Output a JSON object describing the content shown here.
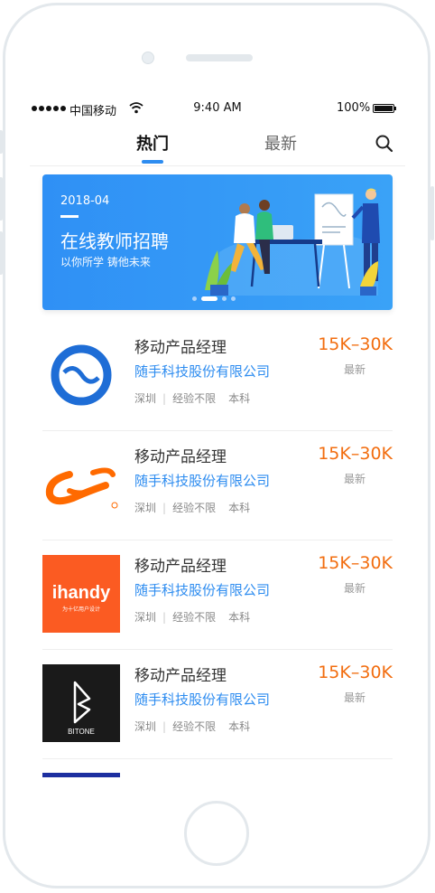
{
  "status_bar": {
    "carrier": "中国移动",
    "time": "9:40 AM",
    "battery": "100%"
  },
  "tabs": [
    {
      "label": "热门",
      "active": true
    },
    {
      "label": "最新",
      "active": false
    }
  ],
  "banner": {
    "date": "2018-04",
    "title": "在线教师招聘",
    "subtitle": "以你所学 铸他未来",
    "page_count": 4,
    "active_page": 2
  },
  "jobs": [
    {
      "title": "移动产品经理",
      "company": "随手科技股份有限公司",
      "location": "深圳",
      "experience": "经验不限",
      "education": "本科",
      "salary": "15K–30K",
      "tag": "最新",
      "logo": "suishou-logo"
    },
    {
      "title": "移动产品经理",
      "company": "随手科技股份有限公司",
      "location": "深圳",
      "experience": "经验不限",
      "education": "本科",
      "salary": "15K–30K",
      "tag": "最新",
      "logo": "alibaba-logo"
    },
    {
      "title": "移动产品经理",
      "company": "随手科技股份有限公司",
      "location": "深圳",
      "experience": "经验不限",
      "education": "本科",
      "salary": "15K–30K",
      "tag": "最新",
      "logo": "ihandy-logo",
      "logo_text": "ihandy",
      "logo_subtext": "为十亿用户设计"
    },
    {
      "title": "移动产品经理",
      "company": "随手科技股份有限公司",
      "location": "深圳",
      "experience": "经验不限",
      "education": "本科",
      "salary": "15K–30K",
      "tag": "最新",
      "logo": "bitone-logo",
      "logo_text": "BITONE"
    }
  ],
  "colors": {
    "accent": "#2d8cf0",
    "salary": "#f26d0f",
    "ihandy": "#fb5b22",
    "bitone": "#1a1a1a",
    "alibaba": "#ff6a00"
  }
}
